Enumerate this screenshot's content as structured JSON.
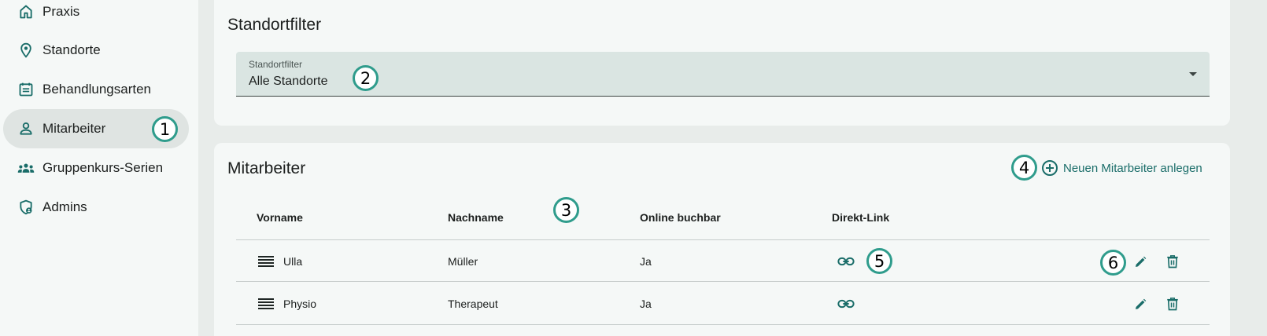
{
  "sidebar": {
    "items": [
      {
        "label": "Praxis",
        "icon": "home-icon"
      },
      {
        "label": "Standorte",
        "icon": "location-pin-icon"
      },
      {
        "label": "Behandlungsarten",
        "icon": "calendar-list-icon"
      },
      {
        "label": "Mitarbeiter",
        "icon": "person-icon",
        "active": true
      },
      {
        "label": "Gruppenkurs-Serien",
        "icon": "group-icon"
      },
      {
        "label": "Admins",
        "icon": "admin-shield-icon"
      }
    ]
  },
  "filter_card": {
    "title": "Standortfilter",
    "select": {
      "label": "Standortfilter",
      "value": "Alle Standorte"
    }
  },
  "staff_card": {
    "title": "Mitarbeiter",
    "add_button_label": "Neuen Mitarbeiter anlegen",
    "columns": [
      "Vorname",
      "Nachname",
      "Online buchbar",
      "Direkt-Link"
    ],
    "rows": [
      {
        "vorname": "Ulla",
        "nachname": "Müller",
        "online": "Ja"
      },
      {
        "vorname": "Physio",
        "nachname": "Therapeut",
        "online": "Ja"
      }
    ]
  },
  "annotations": [
    "1",
    "2",
    "3",
    "4",
    "5",
    "6"
  ],
  "colors": {
    "accent": "#1a6d69",
    "badge_ring": "#2f9c8c",
    "active_nav": "#dfe4e2",
    "select_bg": "#dae5e2"
  }
}
